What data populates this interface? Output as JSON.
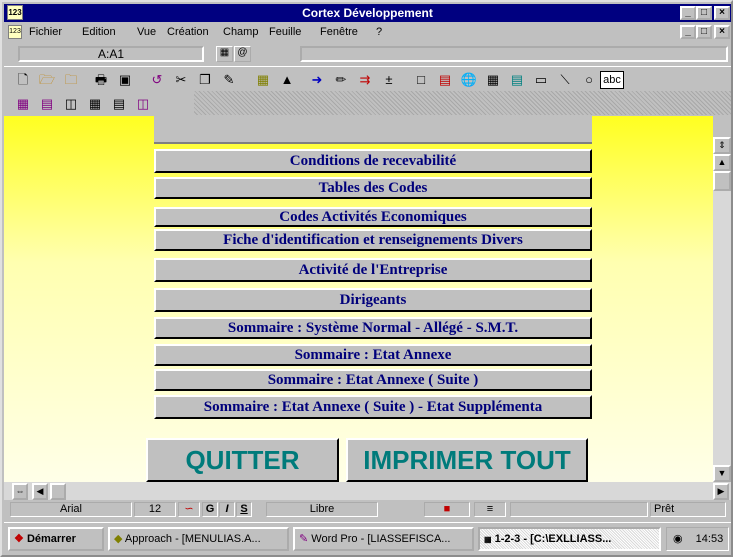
{
  "window": {
    "title": "Cortex Développement",
    "app_icon": "123",
    "controls": [
      "_",
      "□",
      "×"
    ]
  },
  "menu": [
    {
      "label": "Fichier"
    },
    {
      "label": "Edition"
    },
    {
      "label": "Vue"
    },
    {
      "label": "Création"
    },
    {
      "label": "Champ"
    },
    {
      "label": "Feuille"
    },
    {
      "label": "Fenêtre"
    },
    {
      "label": "?"
    }
  ],
  "cell_reference": "A:A1",
  "toolbar_text_tool": "abc",
  "menu_buttons": [
    {
      "label": "Conditions de recevabilité"
    },
    {
      "label": "Tables des Codes"
    },
    {
      "label": "Codes Activités Economiques"
    },
    {
      "label": "Fiche d'identification et renseignements Divers"
    },
    {
      "label": "Activité de l'Entreprise"
    },
    {
      "label": "Dirigeants"
    },
    {
      "label": "Sommaire : Système Normal - Allégé - S.M.T."
    },
    {
      "label": "Sommaire : Etat Annexe"
    },
    {
      "label": "Sommaire : Etat Annexe ( Suite )"
    },
    {
      "label": "Sommaire : Etat Annexe ( Suite ) - Etat Supplémenta"
    }
  ],
  "actions": {
    "quit": "QUITTER",
    "print_all": "IMPRIMER TOUT"
  },
  "statusbar": {
    "font": "Arial",
    "size": "12",
    "bold": "G",
    "italic": "I",
    "underline": "S",
    "style": "Libre",
    "state": "Prêt"
  },
  "taskbar": {
    "start": "Démarrer",
    "tasks": [
      {
        "label": "Approach - [MENULIAS.A..."
      },
      {
        "label": "Word Pro - [LIASSEFISCA..."
      },
      {
        "label": "1-2-3 - [C:\\EXLLIASS..."
      }
    ],
    "clock": "14:53"
  },
  "colors": {
    "title_bar": "#000080",
    "content_yellow": "#ffff20",
    "button_text": "#00007b",
    "big_button_text": "#007b7b"
  }
}
